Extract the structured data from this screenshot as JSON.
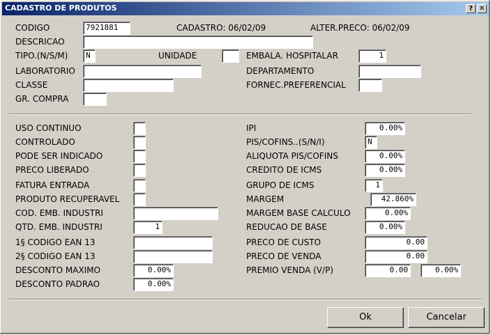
{
  "window": {
    "title": "CADASTRO DE PRODUTOS",
    "help_button": "?",
    "close_button": "✕"
  },
  "header": {
    "codigo_label": "CODIGO",
    "codigo_value": "7921881",
    "cadastro_label": "CADASTRO: 06/02/09",
    "alter_preco_label": "ALTER.PRECO: 06/02/09"
  },
  "top_form": {
    "descricao_label": "DESCRICAO",
    "descricao_value": "",
    "tipo_label": "TIPO.(N/S/M)",
    "tipo_value": "N",
    "unidade_label": "UNIDADE",
    "unidade_value": "",
    "embala_label": "EMBALA. HOSPITALAR",
    "embala_value": "1",
    "laboratorio_label": "LABORATORIO",
    "laboratorio_value": "",
    "departamento_label": "DEPARTAMENTO",
    "departamento_value": "",
    "classe_label": "CLASSE",
    "classe_value": "",
    "fornec_label": "FORNEC.PREFERENCIAL",
    "fornec_value": "",
    "gr_compra_label": "GR. COMPRA",
    "gr_compra_value": ""
  },
  "left_form": {
    "uso_continuo_label": "USO CONTINUO",
    "controlado_label": "CONTROLADO",
    "pode_ser_indicado_label": "PODE SER INDICADO",
    "preco_liberado_label": "PRECO LIBERADO",
    "fatura_entrada_label": "FATURA ENTRADA",
    "produto_recuperavel_label": "PRODUTO RECUPERAVEL",
    "cod_emb_label": "COD. EMB. INDUSTRI",
    "cod_emb_value": "",
    "qtd_emb_label": "QTD. EMB. INDUSTRI",
    "qtd_emb_value": "1",
    "ean1_label": "1§ CODIGO EAN 13",
    "ean1_value": "",
    "ean2_label": "2§ CODIGO EAN 13",
    "ean2_value": "",
    "desconto_maximo_label": "DESCONTO MAXIMO",
    "desconto_maximo_value": "0.00%",
    "desconto_padrao_label": "DESCONTO PADRAO",
    "desconto_padrao_value": "0.00%"
  },
  "right_form": {
    "ipi_label": "IPI",
    "ipi_value": "0.00%",
    "pis_cofins_label": "PIS/COFINS..(S/N/I)",
    "pis_cofins_value": "N",
    "aliquota_label": "ALIQUOTA PIS/COFINS",
    "aliquota_value": "0.00%",
    "credito_icms_label": "CREDITO DE ICMS",
    "credito_icms_value": "0.00%",
    "grupo_icms_label": "GRUPO DE ICMS",
    "grupo_icms_value": "1",
    "margem_label": "MARGEM",
    "margem_value": "42.860%",
    "margem_base_label": "MARGEM BASE CALCULO",
    "margem_base_value": "0.00%",
    "reducao_base_label": "REDUCAO DE BASE",
    "reducao_base_value": "0.00%",
    "preco_custo_label": "PRECO DE CUSTO",
    "preco_custo_value": "0.00",
    "preco_venda_label": "PRECO DE VENDA",
    "preco_venda_value": "0.00",
    "premio_venda_label": "PREMIO VENDA (V/P)",
    "premio_venda_value": "0.00",
    "premio_venda_pct_value": "0.00%"
  },
  "buttons": {
    "ok": "Ok",
    "cancelar": "Cancelar"
  }
}
